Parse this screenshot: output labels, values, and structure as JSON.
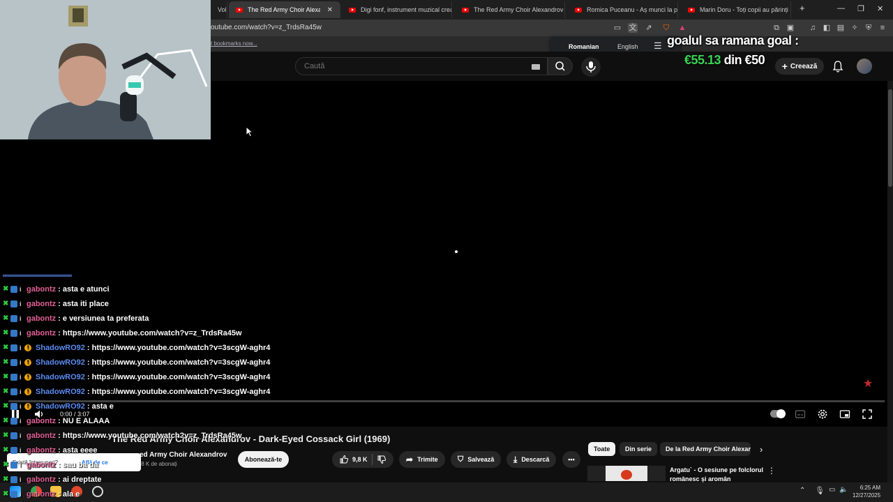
{
  "browser": {
    "tabs": [
      {
        "label": "Volk"
      },
      {
        "label": "The Red Army Choir Alexandrov",
        "active": true
      },
      {
        "label": "Digi fonf, instrument muzical creat d"
      },
      {
        "label": "The Red Army Choir Alexandrov - Ka"
      },
      {
        "label": "Romica Puceanu - Aș munci la plug ş"
      },
      {
        "label": "Marin Doru - Toți copii au părinți - Y"
      }
    ],
    "new_tab": "+",
    "url": "outube.com/watch?v=z_TrdsRa45w",
    "bookmarks_link": "t bookmarks now...",
    "translate": {
      "lang_from": "Romanian",
      "lang_to": "English"
    }
  },
  "goal": {
    "title": "goalul sa ramana goal :",
    "current": "€55.13",
    "sep": "din",
    "target": "€50",
    "current_color": "#39d353"
  },
  "youtube": {
    "search_placeholder": "Caută",
    "create_label": "Creează",
    "video": {
      "time": "0:00 / 3:07",
      "title": "The Red Army Choir Alexandrov - Dark-Eyed Cossack Girl (1969)",
      "channel": "ed Army Choir Alexandrov",
      "subscribers": ",8 K de abonați",
      "subscribe_label": "Abonează-te",
      "likes": "9,8 K",
      "share_label": "Trimite",
      "save_label": "Salvează",
      "download_label": "Descarcă"
    },
    "chips": [
      "Toate",
      "Din serie",
      "De la Red Army Choir Alexan"
    ],
    "recommendation": {
      "title": "Argatu` - O sesiune pe folclorul românesc și aromân"
    }
  },
  "chat": [
    {
      "user": "gabontz",
      "text": ": asta e atunci",
      "kind": "g"
    },
    {
      "user": "gabontz",
      "text": ": asta iti place",
      "kind": "g"
    },
    {
      "user": "gabontz",
      "text": ": e versiunea ta preferata",
      "kind": "g"
    },
    {
      "user": "gabontz",
      "text": ": https://www.youtube.com/watch?v=z_TrdsRa45w",
      "kind": "g"
    },
    {
      "user": "ShadowRO92",
      "text": ": https://www.youtube.com/watch?v=3scgW-aghr4",
      "kind": "s"
    },
    {
      "user": "ShadowRO92",
      "text": ": https://www.youtube.com/watch?v=3scgW-aghr4",
      "kind": "s"
    },
    {
      "user": "ShadowRO92",
      "text": ": https://www.youtube.com/watch?v=3scgW-aghr4",
      "kind": "s"
    },
    {
      "user": "ShadowRO92",
      "text": ": https://www.youtube.com/watch?v=3scgW-aghr4",
      "kind": "s"
    },
    {
      "user": "ShadowRO92",
      "text": ": asta e",
      "kind": "s"
    },
    {
      "user": "gabontz",
      "text": ": NU E ALAAA",
      "kind": "g"
    },
    {
      "user": "gabontz",
      "text": ": https://www.youtube.com/watch?v=z_TrdsRa45w",
      "kind": "g"
    },
    {
      "user": "gabontz",
      "text": ": asta eeee",
      "kind": "g"
    },
    {
      "user": "gabontz",
      "text": ": sau ba da",
      "kind": "g"
    },
    {
      "user": "gabontz",
      "text": ": ai dreptate",
      "kind": "g"
    },
    {
      "user": "gabontz",
      "text": ": ala e",
      "kind": "g"
    }
  ],
  "toast": {
    "question": "Există întreruperi?",
    "link": "Află de ce"
  },
  "taskbar": {
    "time": "6:25 AM",
    "date": "12/27/2025"
  }
}
